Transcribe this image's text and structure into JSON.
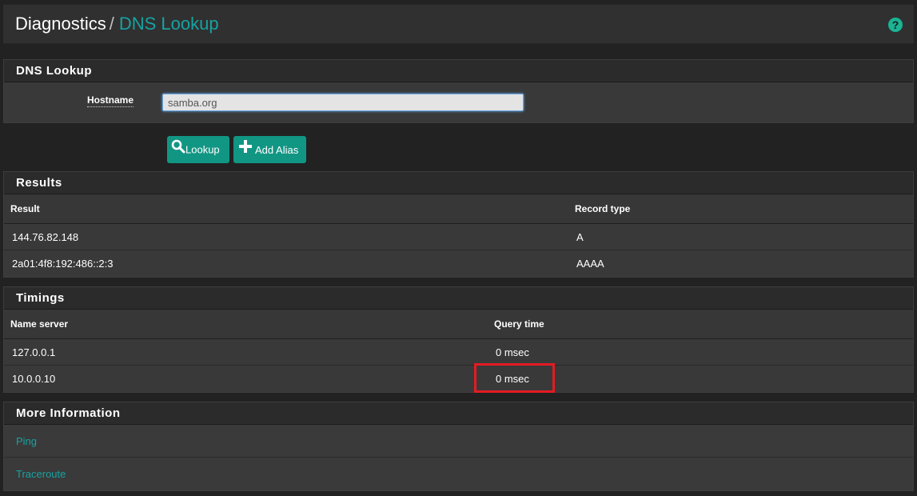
{
  "breadcrumb": {
    "parent": "Diagnostics",
    "separator": "/",
    "current": "DNS Lookup"
  },
  "help_icon": "question-circle-icon",
  "colors": {
    "accent": "#17a2a2",
    "button": "#129684",
    "highlight": "#e21c23",
    "help": "#1ab394"
  },
  "form": {
    "title": "DNS Lookup",
    "hostname_label": "Hostname",
    "hostname_value": "samba.org"
  },
  "buttons": {
    "lookup": {
      "label": "Lookup",
      "icon": "search-icon"
    },
    "add_alias": {
      "label": "Add Alias",
      "icon": "plus-icon"
    }
  },
  "results": {
    "title": "Results",
    "columns": [
      "Result",
      "Record type"
    ],
    "rows": [
      [
        "144.76.82.148",
        "A"
      ],
      [
        "2a01:4f8:192:486::2:3",
        "AAAA"
      ]
    ]
  },
  "timings": {
    "title": "Timings",
    "columns": [
      "Name server",
      "Query time"
    ],
    "rows": [
      [
        "127.0.0.1",
        "0 msec"
      ],
      [
        "10.0.0.10",
        "0 msec"
      ]
    ]
  },
  "more_info": {
    "title": "More Information",
    "links": [
      "Ping",
      "Traceroute"
    ]
  }
}
